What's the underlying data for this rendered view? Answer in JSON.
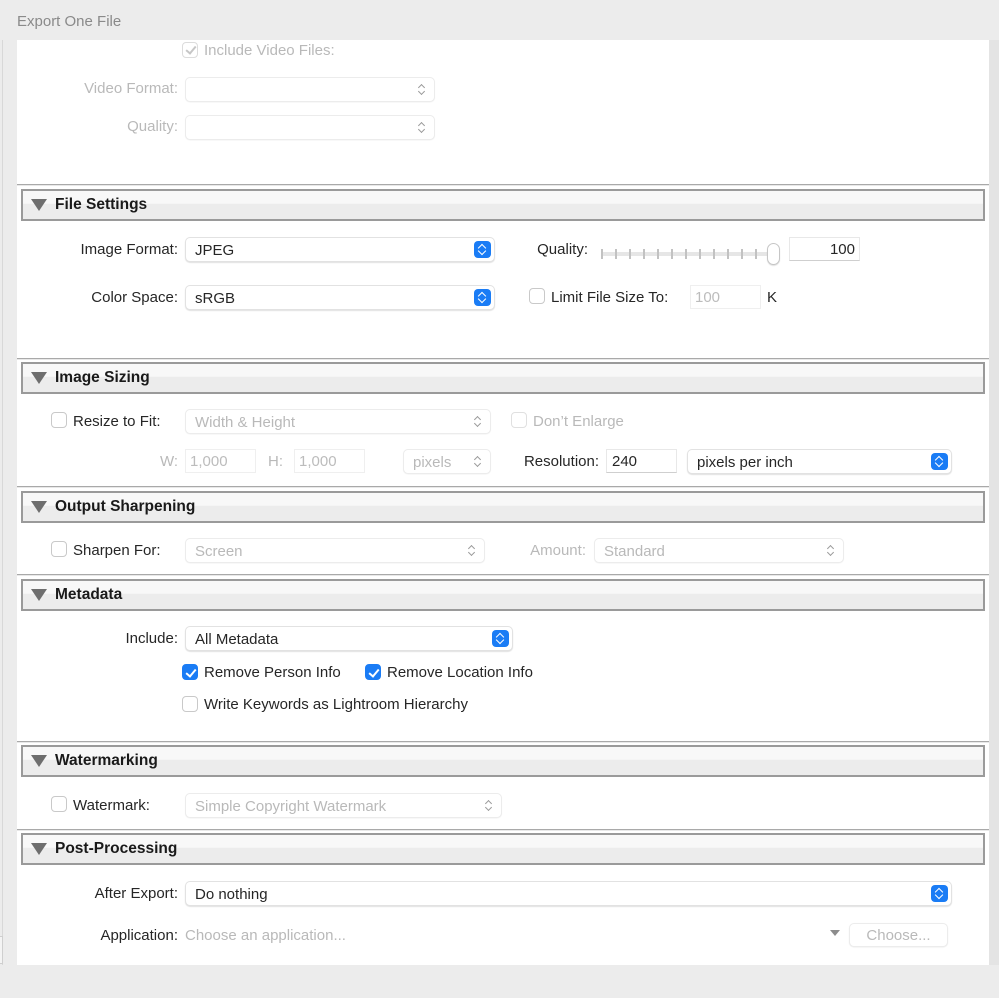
{
  "window": {
    "title": "Export One File"
  },
  "video": {
    "include_label": "Include Video Files:",
    "include_checked": true,
    "format_label": "Video Format:",
    "format_value": "",
    "quality_label": "Quality:",
    "quality_value": ""
  },
  "file_settings": {
    "title": "File Settings",
    "image_format_label": "Image Format:",
    "image_format_value": "JPEG",
    "color_space_label": "Color Space:",
    "color_space_value": "sRGB",
    "quality_label": "Quality:",
    "quality_value": "100",
    "quality_slider_percent": 100,
    "limit_label": "Limit File Size To:",
    "limit_checked": false,
    "limit_value": "100",
    "limit_unit": "K"
  },
  "image_sizing": {
    "title": "Image Sizing",
    "resize_label": "Resize to Fit:",
    "resize_checked": false,
    "resize_value": "Width & Height",
    "dont_enlarge_label": "Don’t Enlarge",
    "dont_enlarge_checked": false,
    "w_label": "W:",
    "w_value": "1,000",
    "h_label": "H:",
    "h_value": "1,000",
    "unit_value": "pixels",
    "resolution_label": "Resolution:",
    "resolution_value": "240",
    "resolution_unit_value": "pixels per inch"
  },
  "output_sharpening": {
    "title": "Output Sharpening",
    "sharpen_label": "Sharpen For:",
    "sharpen_checked": false,
    "sharpen_value": "Screen",
    "amount_label": "Amount:",
    "amount_value": "Standard"
  },
  "metadata": {
    "title": "Metadata",
    "include_label": "Include:",
    "include_value": "All Metadata",
    "remove_person_label": "Remove Person Info",
    "remove_person_checked": true,
    "remove_location_label": "Remove Location Info",
    "remove_location_checked": true,
    "write_keywords_label": "Write Keywords as Lightroom Hierarchy",
    "write_keywords_checked": false
  },
  "watermarking": {
    "title": "Watermarking",
    "watermark_label": "Watermark:",
    "watermark_checked": false,
    "watermark_value": "Simple Copyright Watermark"
  },
  "post_processing": {
    "title": "Post-Processing",
    "after_export_label": "After Export:",
    "after_export_value": "Do nothing",
    "application_label": "Application:",
    "application_placeholder": "Choose an application...",
    "choose_button": "Choose..."
  },
  "colors": {
    "accent": "#1a7cf5",
    "background": "#ececec",
    "panel": "#ffffff"
  }
}
